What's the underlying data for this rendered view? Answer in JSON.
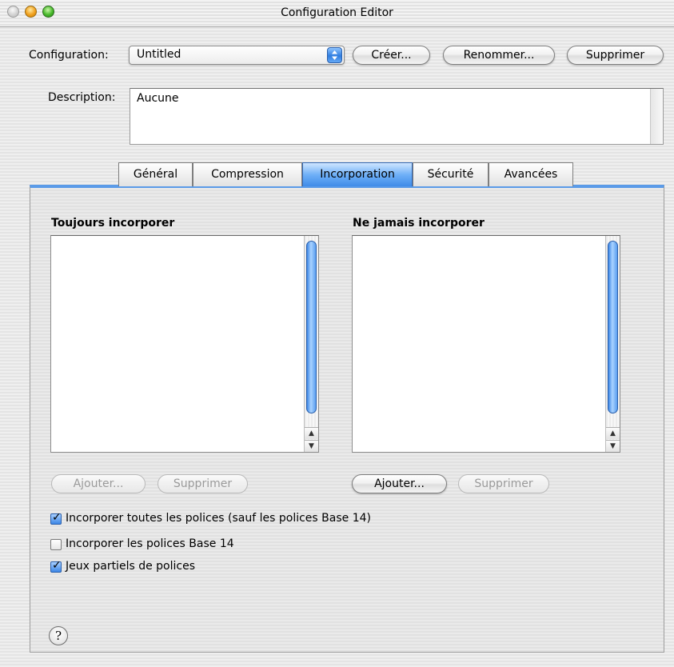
{
  "window": {
    "title": "Configuration Editor"
  },
  "config": {
    "label": "Configuration:",
    "selected": "Untitled",
    "create": "Créer...",
    "rename": "Renommer...",
    "delete": "Supprimer"
  },
  "description": {
    "label": "Description:",
    "value": "Aucune"
  },
  "tabs": [
    {
      "label": "Général"
    },
    {
      "label": "Compression"
    },
    {
      "label": "Incorporation",
      "active": true
    },
    {
      "label": "Sécurité"
    },
    {
      "label": "Avancées"
    }
  ],
  "panel": {
    "always": {
      "heading": "Toujours incorporer",
      "add": "Ajouter...",
      "remove": "Supprimer",
      "add_enabled": false,
      "remove_enabled": false
    },
    "never": {
      "heading": "Ne jamais incorporer",
      "add": "Ajouter...",
      "remove": "Supprimer",
      "add_enabled": true,
      "remove_enabled": false
    },
    "checkboxes": [
      {
        "label": "Incorporer toutes les polices (sauf les polices Base 14)",
        "checked": true
      },
      {
        "label": "Incorporer les polices Base 14",
        "checked": false
      },
      {
        "label": "Jeux partiels de polices",
        "checked": true
      }
    ],
    "help_glyph": "?"
  },
  "colors": {
    "accent": "#3f8be8",
    "disabled_text": "#9a9a9a"
  }
}
